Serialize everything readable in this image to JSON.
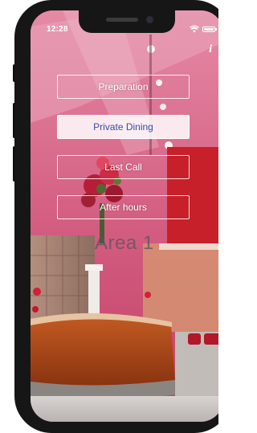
{
  "status_bar": {
    "time": "12:28"
  },
  "icons": {
    "info": "i",
    "wifi": "wifi-icon",
    "battery": "battery-icon"
  },
  "menu": {
    "items": [
      {
        "label": "Preparation",
        "selected": false
      },
      {
        "label": "Private Dining",
        "selected": true
      },
      {
        "label": "Last Call",
        "selected": false
      },
      {
        "label": "After hours",
        "selected": false
      }
    ]
  },
  "area": {
    "label": "Area 1"
  },
  "colors": {
    "selected_text": "#3a4aa8",
    "accent_red": "#c8202a"
  }
}
